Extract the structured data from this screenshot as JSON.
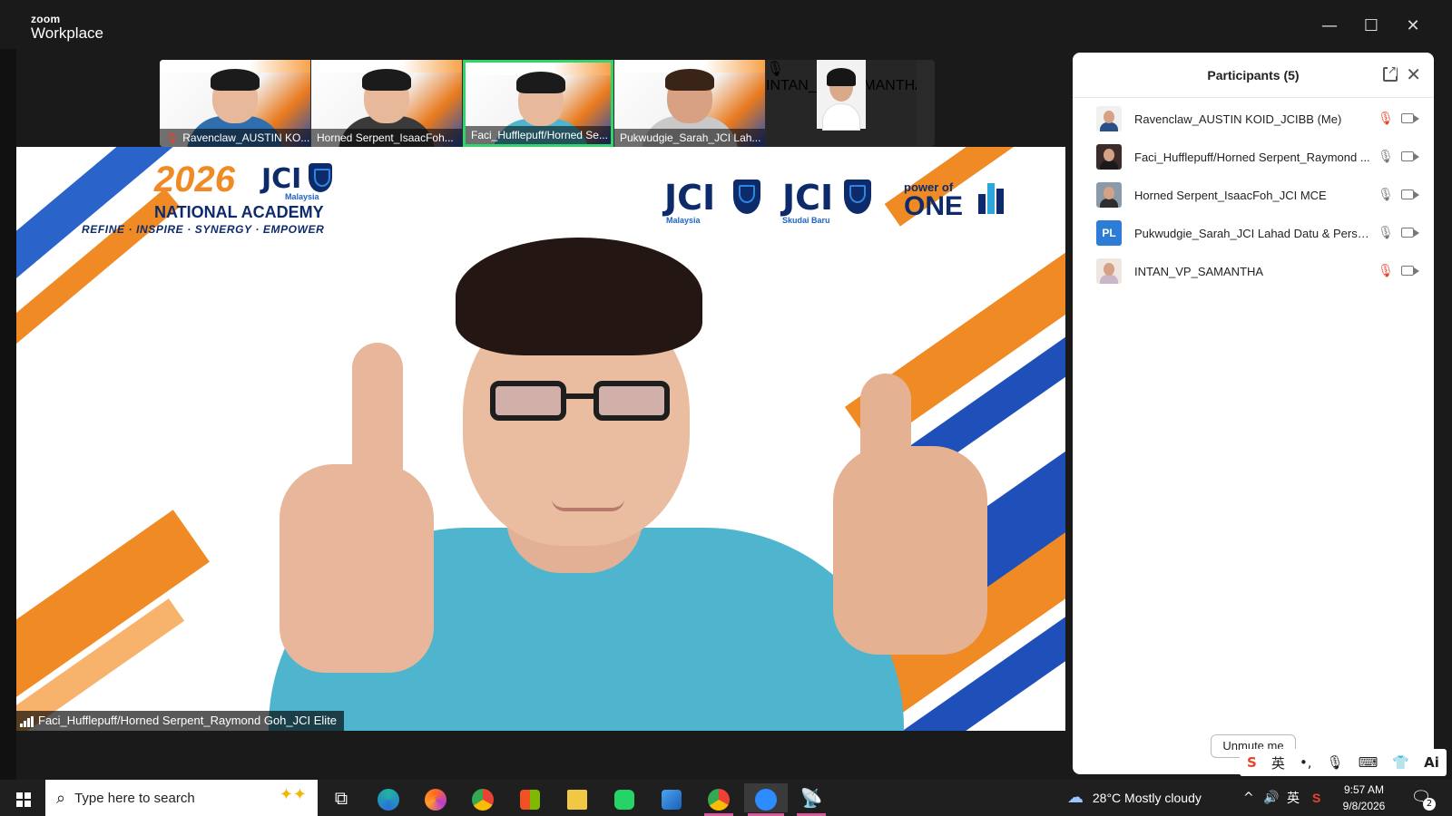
{
  "app": {
    "brand_small": "zoom",
    "brand_name": "Workplace"
  },
  "window_controls": {
    "minimize": "—",
    "maximize": "☐",
    "close": "✕"
  },
  "thumbnails": [
    {
      "name": "Ravenclaw_AUSTIN KO...",
      "muted": true,
      "active": false
    },
    {
      "name": "Horned Serpent_IsaacFoh...",
      "muted": false,
      "active": false
    },
    {
      "name": "Faci_Hufflepuff/Horned Se...",
      "muted": false,
      "active": true
    },
    {
      "name": "Pukwudgie_Sarah_JCI Lah...",
      "muted": false,
      "active": false
    },
    {
      "name": "INTAN_VP_SAMANTHA",
      "muted": true,
      "active": false
    }
  ],
  "main_video": {
    "banner_year": "2026",
    "banner_org": "JCI",
    "banner_country": "Malaysia",
    "banner_title": "NATIONAL ACADEMY",
    "banner_tagline": "REFINE · INSPIRE · SYNERGY · EMPOWER",
    "logo_jci_1": "JCI",
    "logo_jci_1_sub": "Malaysia",
    "logo_jci_2": "JCI",
    "logo_jci_2_sub": "Skudai Baru",
    "power_small": "power of",
    "power_big": "ONE",
    "speaker_name": "Faci_Hufflepuff/Horned Serpent_Raymond Goh_JCI Elite"
  },
  "participants_panel": {
    "title": "Participants (5)",
    "participants": [
      {
        "name": "Ravenclaw_AUSTIN KOID_JCIBB (Me)",
        "initials": "",
        "mic_muted": true
      },
      {
        "name": "Faci_Hufflepuff/Horned Serpent_Raymond ...",
        "initials": "",
        "mic_muted": false
      },
      {
        "name": "Horned Serpent_IsaacFoh_JCI MCE",
        "initials": "",
        "mic_muted": false
      },
      {
        "name": "Pukwudgie_Sarah_JCI Lahad Datu & Persatu...",
        "initials": "PL",
        "mic_muted": false
      },
      {
        "name": "INTAN_VP_SAMANTHA",
        "initials": "",
        "mic_muted": true
      }
    ],
    "unmute_label": "Unmute me"
  },
  "ime_bar": {
    "items": [
      "S",
      "英",
      "•,",
      "mic-icon",
      "keyboard-icon",
      "shirt-icon",
      "Ai"
    ]
  },
  "taskbar": {
    "search_placeholder": "Type here to search",
    "weather": "28°C  Mostly cloudy",
    "ime_lang": "英",
    "time": "9:57 AM",
    "date": "9/8/2026",
    "notification_count": "2"
  },
  "colors": {
    "active_border": "#33d36b",
    "muted_red": "#e8442b",
    "avatar_blue": "#2d7cd6",
    "banner_orange": "#ef8a24",
    "banner_navy": "#0d2b6b"
  }
}
